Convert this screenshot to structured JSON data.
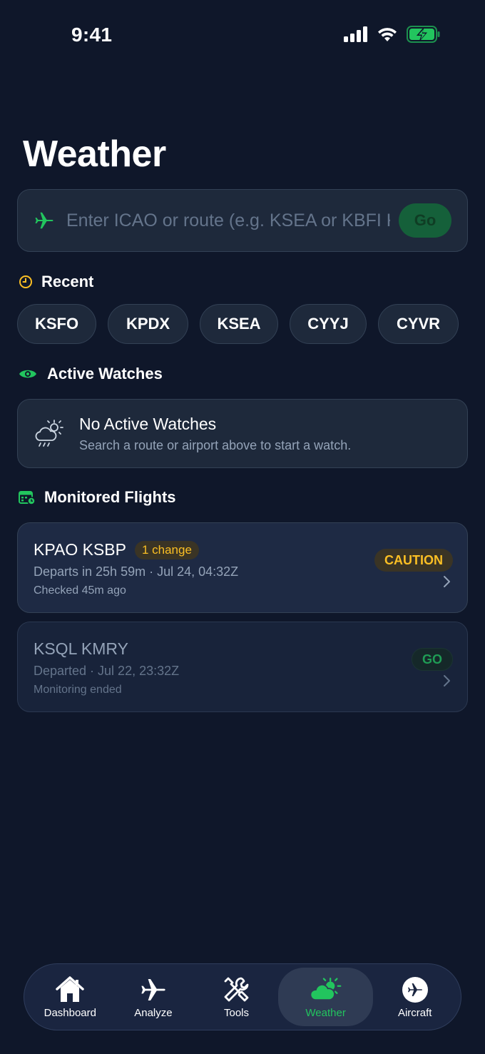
{
  "status_bar": {
    "time": "9:41"
  },
  "page": {
    "title": "Weather"
  },
  "search": {
    "placeholder": "Enter ICAO or route (e.g. KSEA or KBFI KPDX)",
    "value": "",
    "go_label": "Go"
  },
  "recent": {
    "heading": "Recent",
    "chips": [
      "KSFO",
      "KPDX",
      "KSEA",
      "CYYJ",
      "CYVR"
    ]
  },
  "watches": {
    "heading": "Active Watches",
    "empty_title": "No Active Watches",
    "empty_subtitle": "Search a route or airport above to start a watch."
  },
  "flights": {
    "heading": "Monitored Flights",
    "items": [
      {
        "route": "KPAO KSBP",
        "badge": "1 change",
        "departs": "Departs in 25h 59m · Jul 24, 04:32Z",
        "checked": "Checked 45m ago",
        "status": "CAUTION"
      },
      {
        "route": "KSQL KMRY",
        "departs": "Departed · Jul 22, 23:32Z",
        "checked": "Monitoring ended",
        "status": "GO"
      }
    ]
  },
  "tabs": [
    {
      "label": "Dashboard",
      "icon": "house-icon"
    },
    {
      "label": "Analyze",
      "icon": "airplane-icon"
    },
    {
      "label": "Tools",
      "icon": "tools-icon"
    },
    {
      "label": "Weather",
      "icon": "sun-cloud-icon",
      "active": true
    },
    {
      "label": "Aircraft",
      "icon": "airplane-circle-icon"
    }
  ],
  "colors": {
    "background": "#0f172a",
    "accent_green": "#22c55e",
    "caution_amber": "#fbbf24",
    "card": "#1e293b"
  }
}
